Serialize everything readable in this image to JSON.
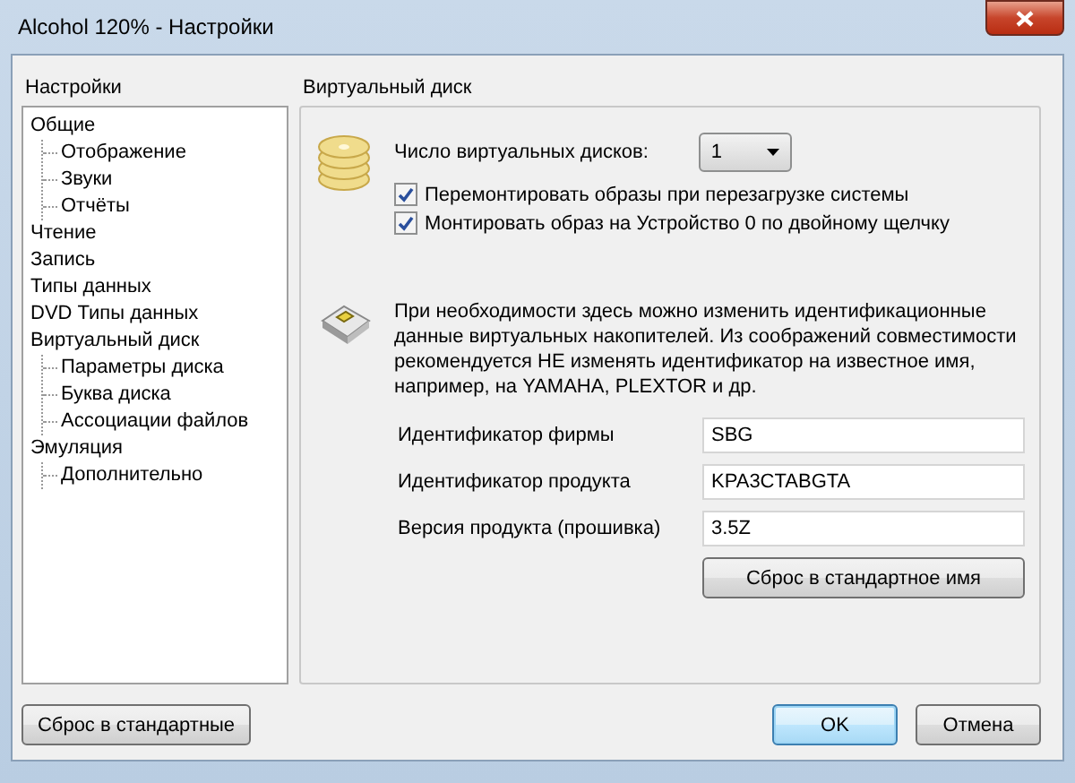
{
  "window": {
    "title": "Alcohol 120% - Настройки"
  },
  "sidebar": {
    "title": "Настройки",
    "items": [
      {
        "label": "Общие",
        "children": [
          {
            "label": "Отображение"
          },
          {
            "label": "Звуки"
          },
          {
            "label": "Отчёты"
          }
        ]
      },
      {
        "label": "Чтение"
      },
      {
        "label": "Запись"
      },
      {
        "label": "Типы данных"
      },
      {
        "label": "DVD Типы данных"
      },
      {
        "label": "Виртуальный диск",
        "children": [
          {
            "label": "Параметры диска"
          },
          {
            "label": "Буква диска"
          },
          {
            "label": "Ассоциации файлов"
          }
        ]
      },
      {
        "label": "Эмуляция",
        "children": [
          {
            "label": "Дополнительно"
          }
        ]
      }
    ]
  },
  "panel": {
    "title": "Виртуальный диск",
    "disk_count": {
      "label": "Число виртуальных дисков:",
      "value": "1"
    },
    "options": [
      {
        "label": "Перемонтировать образы при перезагрузке системы",
        "checked": true
      },
      {
        "label": "Монтировать образ на Устройство 0 по двойному щелчку",
        "checked": true
      }
    ],
    "description": "При необходимости здесь можно изменить идентификационные данные виртуальных накопителей. Из соображений совместимости рекомендуется НЕ изменять идентификатор на известное имя, например, на YAMAHA, PLEXTOR и др.",
    "fields": [
      {
        "label": "Идентификатор фирмы",
        "value": "SBG"
      },
      {
        "label": "Идентификатор продукта",
        "value": "KPA3CTABGTA"
      },
      {
        "label": "Версия продукта (прошивка)",
        "value": "3.5Z"
      }
    ],
    "reset_name_button": "Сброс в стандартное имя"
  },
  "buttons": {
    "reset": "Сброс в стандартные",
    "ok": "OK",
    "cancel": "Отмена"
  }
}
